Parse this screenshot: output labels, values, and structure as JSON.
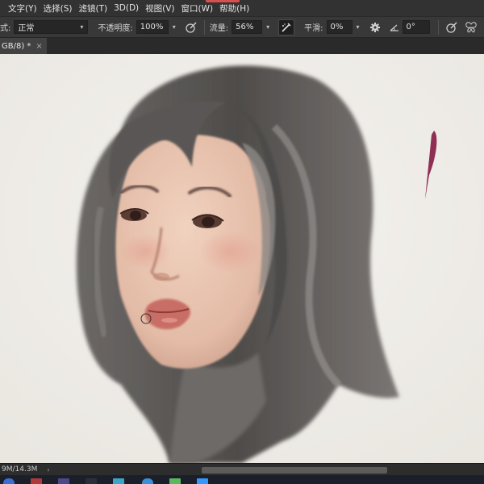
{
  "menu": {
    "items": [
      "文字(Y)",
      "选择(S)",
      "滤镜(T)",
      "3D(D)",
      "视图(V)",
      "窗口(W)",
      "帮助(H)"
    ]
  },
  "options": {
    "mode_label_partial": "式:",
    "mode_value": "正常",
    "opacity_label": "不透明度:",
    "opacity_value": "100%",
    "flow_label": "流量:",
    "flow_value": "56%",
    "smoothing_label": "平滑:",
    "smoothing_value": "0%",
    "angle_value": "0°"
  },
  "document": {
    "tab_title": "GB/8) *",
    "tab_close": "×"
  },
  "status": {
    "doc_size": "9M/14.3M",
    "arrow": "›"
  },
  "colors": {
    "canvas_bg": "#f1efea",
    "hair": "#5e5b58",
    "skin": "#e6c2ad",
    "lips": "#c96e66",
    "brush_stroke": "#8f2f55",
    "accent": "#d8504d"
  }
}
